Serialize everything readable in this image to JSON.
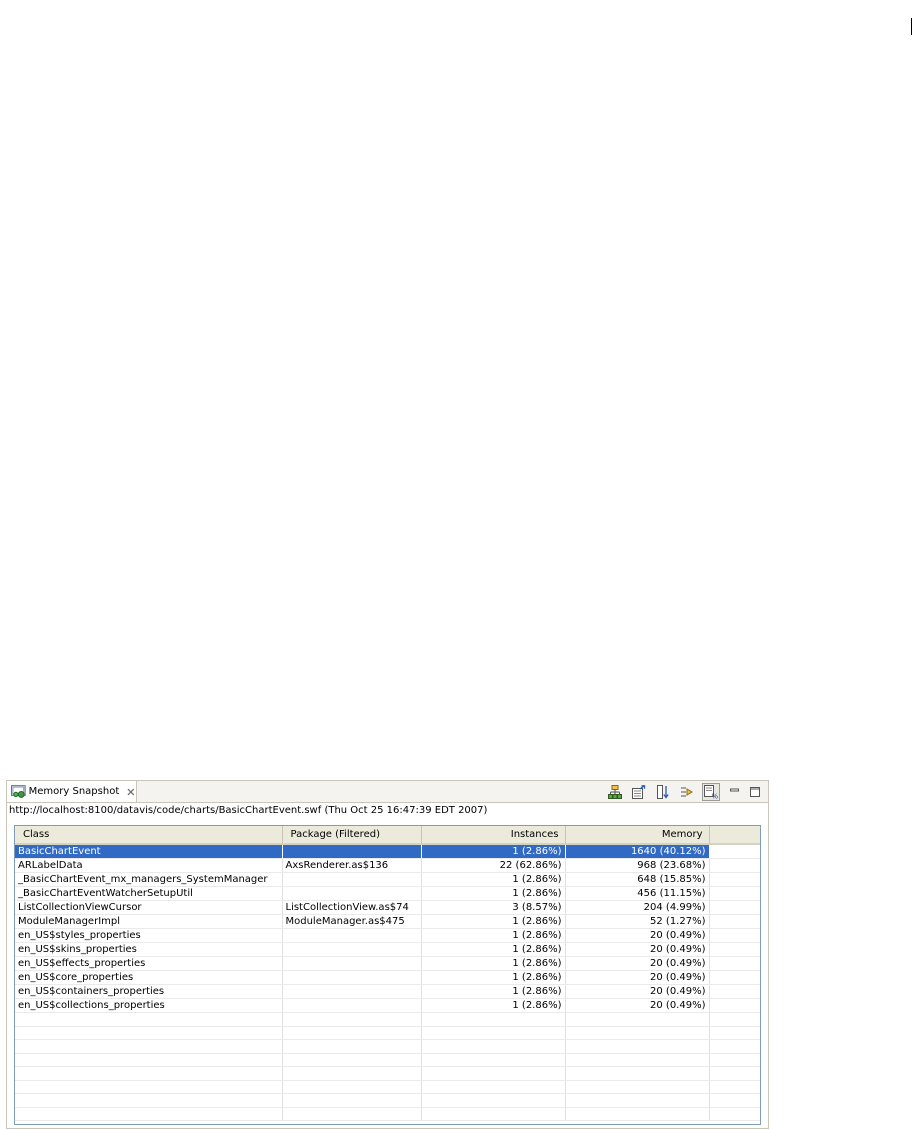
{
  "view": {
    "tab_label": "Memory Snapshot",
    "tab_icon": "memory-snapshot-icon",
    "close_icon": "close-icon",
    "toolbar": [
      {
        "name": "hierarchy-icon",
        "tooltip": ""
      },
      {
        "name": "export-icon",
        "tooltip": ""
      },
      {
        "name": "sort-icon",
        "tooltip": ""
      },
      {
        "name": "filter-icon",
        "tooltip": ""
      },
      {
        "name": "percent-icon",
        "tooltip": ""
      },
      {
        "name": "minimize-icon",
        "tooltip": ""
      },
      {
        "name": "maximize-icon",
        "tooltip": ""
      }
    ],
    "url": "http://localhost:8100/datavis/code/charts/BasicChartEvent.swf (Thu Oct 25 16:47:39 EDT 2007)"
  },
  "table": {
    "headers": {
      "class": "Class",
      "package": "Package (Filtered)",
      "instances": "Instances",
      "memory": "Memory"
    },
    "rows": [
      {
        "class": "BasicChartEvent",
        "package": "",
        "instances": "1 (2.86%)",
        "memory": "1640 (40.12%)"
      },
      {
        "class": "ARLabelData",
        "package": "AxsRenderer.as$136",
        "instances": "22 (62.86%)",
        "memory": "968 (23.68%)"
      },
      {
        "class": "_BasicChartEvent_mx_managers_SystemManager",
        "package": "",
        "instances": "1 (2.86%)",
        "memory": "648 (15.85%)"
      },
      {
        "class": "_BasicChartEventWatcherSetupUtil",
        "package": "",
        "instances": "1 (2.86%)",
        "memory": "456 (11.15%)"
      },
      {
        "class": "ListCollectionViewCursor",
        "package": "ListCollectionView.as$74",
        "instances": "3 (8.57%)",
        "memory": "204 (4.99%)"
      },
      {
        "class": "ModuleManagerImpl",
        "package": "ModuleManager.as$475",
        "instances": "1 (2.86%)",
        "memory": "52 (1.27%)"
      },
      {
        "class": "en_US$styles_properties",
        "package": "",
        "instances": "1 (2.86%)",
        "memory": "20 (0.49%)"
      },
      {
        "class": "en_US$skins_properties",
        "package": "",
        "instances": "1 (2.86%)",
        "memory": "20 (0.49%)"
      },
      {
        "class": "en_US$effects_properties",
        "package": "",
        "instances": "1 (2.86%)",
        "memory": "20 (0.49%)"
      },
      {
        "class": "en_US$core_properties",
        "package": "",
        "instances": "1 (2.86%)",
        "memory": "20 (0.49%)"
      },
      {
        "class": "en_US$containers_properties",
        "package": "",
        "instances": "1 (2.86%)",
        "memory": "20 (0.49%)"
      },
      {
        "class": "en_US$collections_properties",
        "package": "",
        "instances": "1 (2.86%)",
        "memory": "20 (0.49%)"
      }
    ],
    "selected_row": 0,
    "colors": {
      "selection": "#316ac5",
      "header": "#ebeadb"
    }
  }
}
